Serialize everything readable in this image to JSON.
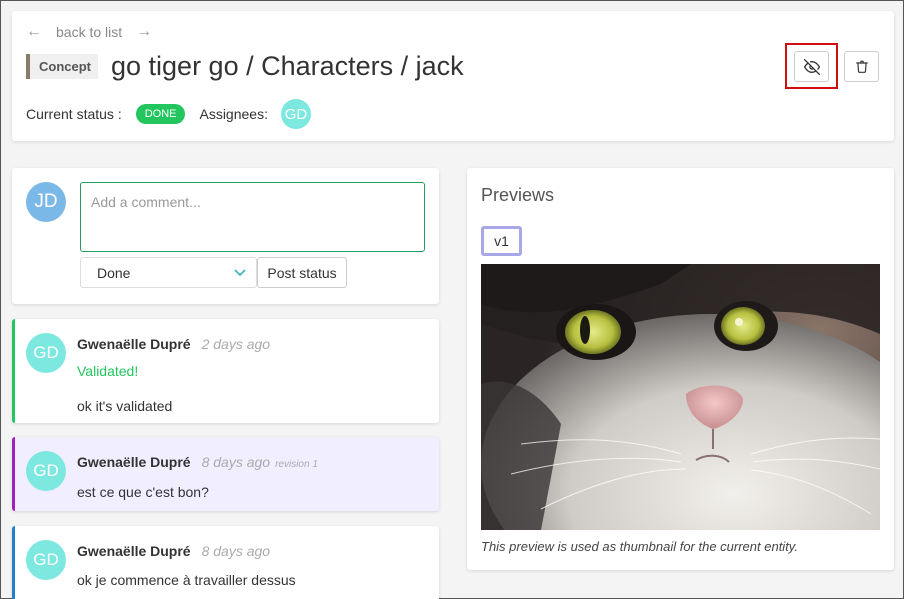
{
  "header": {
    "back_label": "back to list",
    "prev_arrow": "←",
    "next_arrow": "→",
    "task_type": "Concept",
    "title": "go tiger go / Characters / jack",
    "status_label": "Current status :",
    "status_badge": "DONE",
    "assignees_label": "Assignees:",
    "assignee_initials": "GD",
    "icons": {
      "visibility": "eye-off-icon",
      "delete": "trash-icon"
    },
    "colors": {
      "status": "#22c55e",
      "highlight": "#d01010"
    }
  },
  "comment_form": {
    "user_initials": "JD",
    "placeholder": "Add a comment...",
    "status_select": "Done",
    "post_button": "Post status"
  },
  "comments": [
    {
      "initials": "GD",
      "author": "Gwenaëlle Dupré",
      "time": "2 days ago",
      "revision": "",
      "status": "Validated!",
      "text": "ok it's validated",
      "color": "#22c55e"
    },
    {
      "initials": "GD",
      "author": "Gwenaëlle Dupré",
      "time": "8 days ago",
      "revision": "revision 1",
      "status": "",
      "text": "est ce que c'est bon?",
      "color": "#a020c0"
    },
    {
      "initials": "GD",
      "author": "Gwenaëlle Dupré",
      "time": "8 days ago",
      "revision": "",
      "status": "",
      "text": "ok je commence à travailler dessus",
      "color": "#2080d0"
    }
  ],
  "previews": {
    "title": "Previews",
    "revision_tab": "v1",
    "image_subject": "cat-closeup",
    "caption": "This preview is used as thumbnail for the current entity."
  }
}
